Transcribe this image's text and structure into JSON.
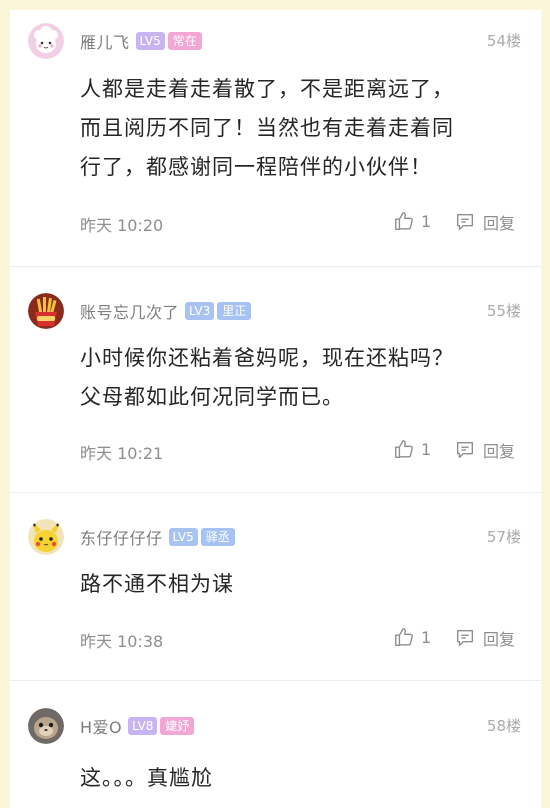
{
  "colors": {
    "page_background": "#fbf6da",
    "card_background": "#ffffff",
    "level_badge": "#c9b4f2",
    "level_badge_blue": "#a9c3f1",
    "title_pink": "#f2a6d6",
    "title_blue": "#a6c2f2",
    "meta_text": "#8e8e8e"
  },
  "comments": [
    {
      "username": "雁儿飞",
      "level": "LV5",
      "title": "常在",
      "floor": "54楼",
      "avatar_icon": "cloud-girl-avatar",
      "content_lines": [
        "人都是走着走着散了，不是距离远了，",
        "而且阅历不同了！当然也有走着走着同",
        "行了，都感谢同一程陪伴的小伙伴！"
      ],
      "time": "昨天 10:20",
      "likes": "1",
      "reply_label": "回复"
    },
    {
      "username": "账号忘几次了",
      "level": "LV3",
      "title": "里正",
      "floor": "55楼",
      "avatar_icon": "fries-avatar",
      "content_lines": [
        "小时候你还粘着爸妈呢，现在还粘吗？",
        "父母都如此何况同学而已。"
      ],
      "time": "昨天 10:21",
      "likes": "1",
      "reply_label": "回复"
    },
    {
      "username": "东仔仔仔仔",
      "level": "LV5",
      "title": "驿丞",
      "floor": "57楼",
      "avatar_icon": "pikachu-avatar",
      "content_lines": [
        "路不通不相为谋"
      ],
      "time": "昨天 10:38",
      "likes": "1",
      "reply_label": "回复"
    },
    {
      "username": "H爱O",
      "level": "LV8",
      "title": "婕妤",
      "floor": "58楼",
      "avatar_icon": "monkey-avatar",
      "content_lines": [
        "这。。。真尴尬"
      ]
    }
  ]
}
